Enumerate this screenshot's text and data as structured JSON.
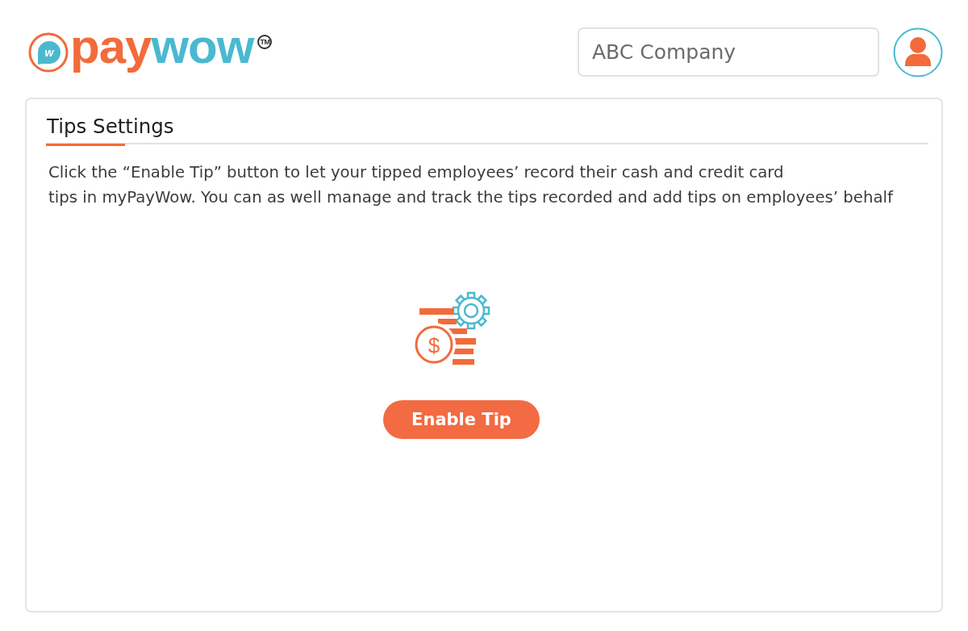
{
  "header": {
    "logo": {
      "badge_letter": "w",
      "parts": [
        {
          "text": "pay",
          "color": "#f26b3a"
        },
        {
          "text": "wow",
          "color": "#4ab9cf"
        }
      ],
      "trademark": "TM"
    },
    "company_field": {
      "value": "ABC Company"
    }
  },
  "tips_settings": {
    "title": "Tips Settings",
    "description_lines": [
      "Click the “Enable Tip” button to let your tipped employees’ record their cash and credit card",
      "tips in myPayWow. You can as well manage and track the tips recorded and add tips on employees’ behalf"
    ],
    "illustration": {
      "coin_symbol": "$"
    },
    "enable_button": {
      "label": "Enable Tip"
    }
  }
}
